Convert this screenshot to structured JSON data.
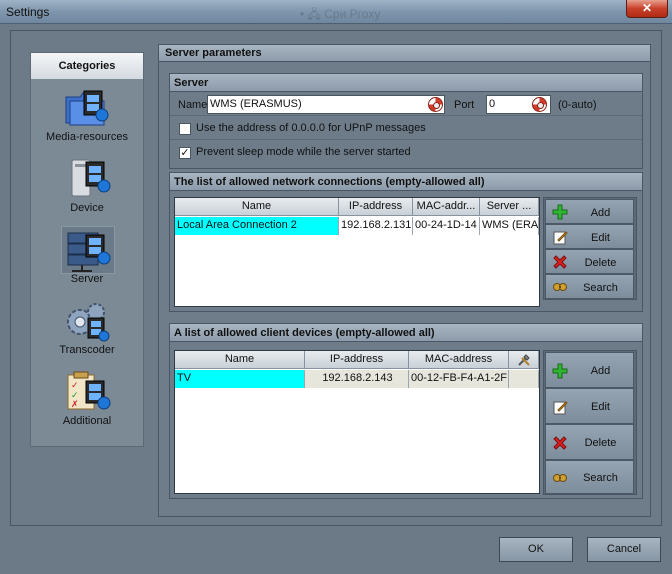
{
  "window": {
    "title": "Settings",
    "background_ghost": "• 🖧 Сри Ргоxу"
  },
  "categories": {
    "header": "Categories",
    "items": [
      {
        "label": "Media-resources",
        "icon": "media-resources-icon"
      },
      {
        "label": "Device",
        "icon": "device-icon"
      },
      {
        "label": "Server",
        "icon": "server-icon",
        "active": true
      },
      {
        "label": "Transcoder",
        "icon": "transcoder-icon"
      },
      {
        "label": "Additional",
        "icon": "additional-icon"
      }
    ]
  },
  "params": {
    "title": "Server parameters",
    "server": {
      "title": "Server",
      "name_label": "Name",
      "name_value": "WMS (ERASMUS)",
      "port_label": "Port",
      "port_value": "0",
      "port_hint": "(0-auto)",
      "upnp_label": "Use the address of 0.0.0.0 for UPnP messages",
      "upnp_checked": false,
      "sleep_label": "Prevent sleep mode while the server started",
      "sleep_checked": true
    },
    "network": {
      "title": "The list of allowed network connections (empty-allowed all)",
      "columns": [
        "Name",
        "IP-address",
        "MAC-addr...",
        "Server ..."
      ],
      "rows": [
        [
          "Local Area Connection 2",
          "192.168.2.131",
          "00-24-1D-14",
          "WMS (ERAS"
        ]
      ],
      "buttons": [
        "Add",
        "Edit",
        "Delete",
        "Search"
      ]
    },
    "clients": {
      "title": "A list of allowed client devices (empty-allowed all)",
      "columns": [
        "Name",
        "IP-address",
        "MAC-address"
      ],
      "rows": [
        [
          "TV",
          "192.168.2.143",
          "00-12-FB-F4-A1-2F"
        ]
      ],
      "buttons": [
        "Add",
        "Edit",
        "Delete",
        "Search"
      ]
    }
  },
  "dialog": {
    "ok": "OK",
    "cancel": "Cancel"
  }
}
